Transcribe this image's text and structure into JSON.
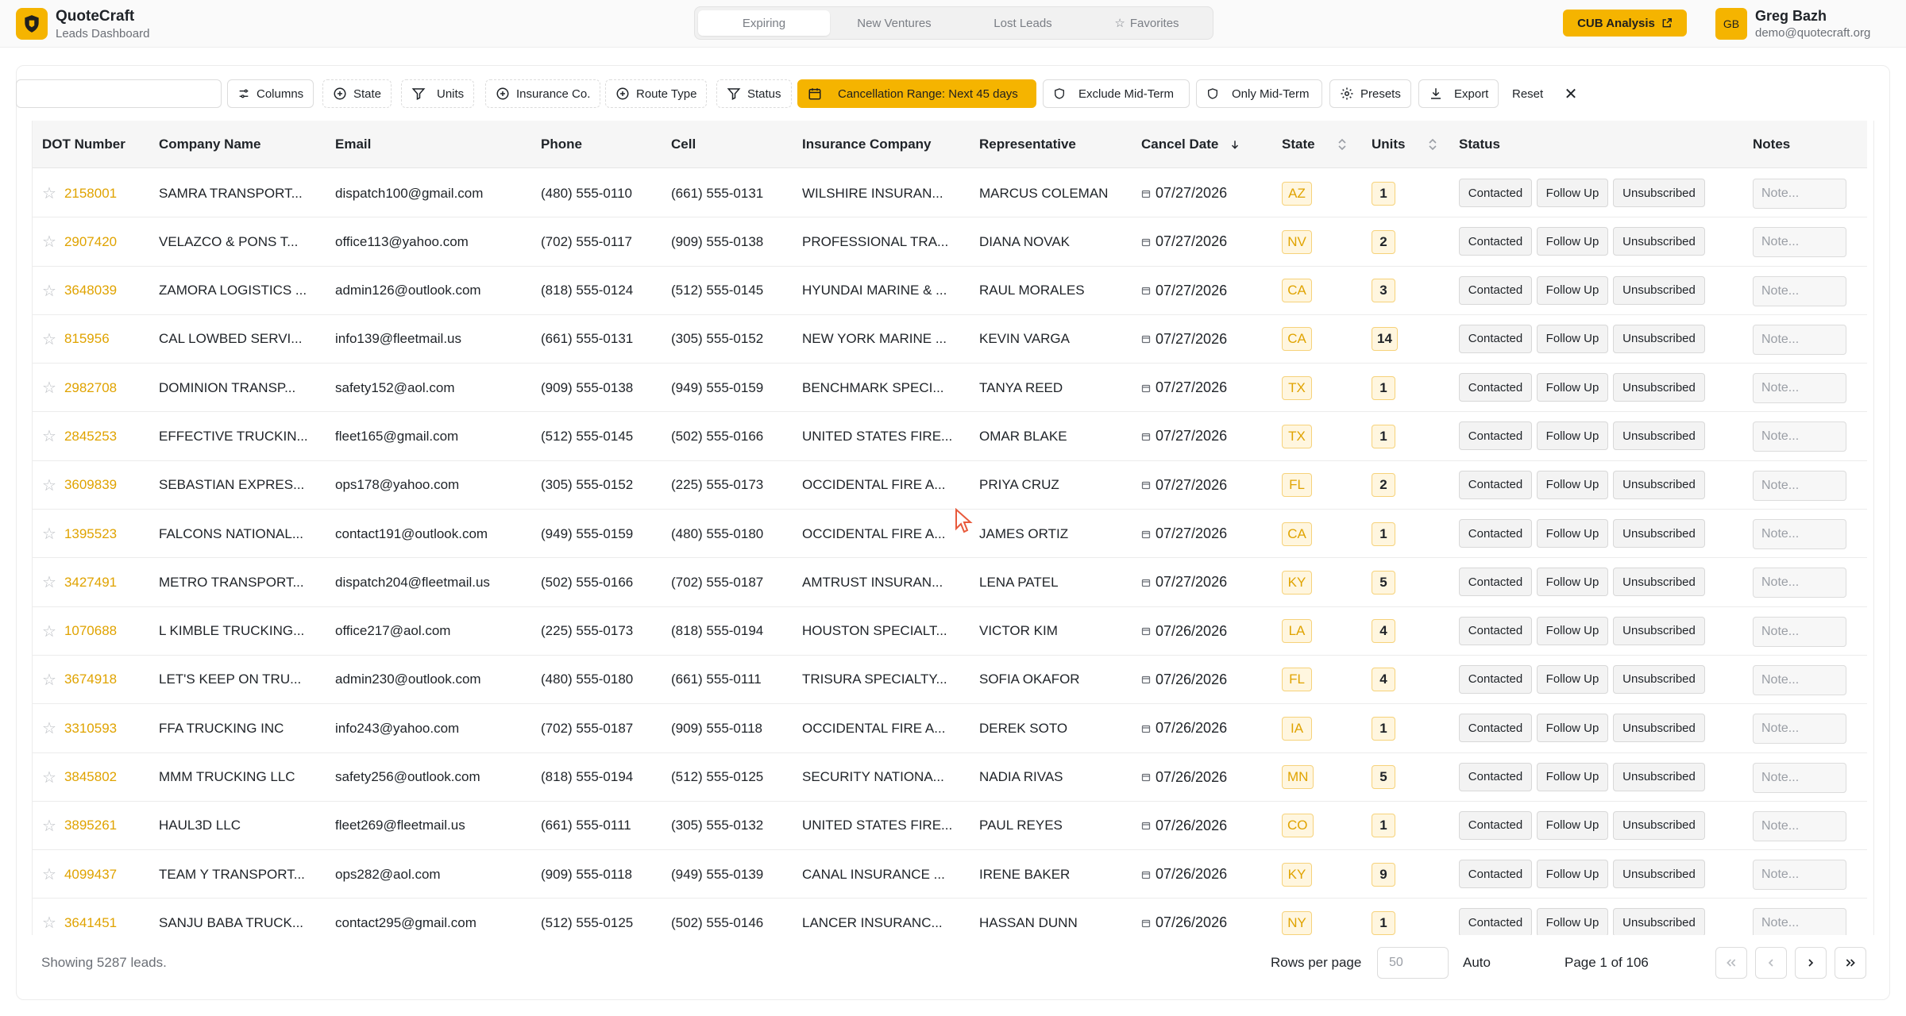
{
  "app": {
    "name": "QuoteCraft",
    "subtitle": "Leads Dashboard"
  },
  "tabs": [
    {
      "label": "Expiring",
      "active": true
    },
    {
      "label": "New Ventures",
      "active": false
    },
    {
      "label": "Lost Leads",
      "active": false
    },
    {
      "label": "Favorites",
      "active": false,
      "icon": "star-icon"
    }
  ],
  "header": {
    "cub_label": "CUB Analysis",
    "avatar_initials": "GB",
    "user_name": "Greg Bazh",
    "user_email": "demo@quotecraft.org"
  },
  "colors": {
    "accent": "#f5b400",
    "link": "#e0a300"
  },
  "toolbar": {
    "search_placeholder": "",
    "columns": "Columns",
    "state": "State",
    "units": "Units",
    "insurance": "Insurance Co.",
    "route": "Route Type",
    "status": "Status",
    "cancel_range": "Cancellation Range: Next 45 days",
    "exclude_mid": "Exclude Mid-Term",
    "only_mid": "Only Mid-Term",
    "presets": "Presets",
    "export": "Export",
    "reset": "Reset",
    "close": "✕"
  },
  "table": {
    "headers": {
      "dot": "DOT Number",
      "company": "Company Name",
      "email": "Email",
      "phone": "Phone",
      "cell": "Cell",
      "insurance": "Insurance Company",
      "rep": "Representative",
      "cancel": "Cancel Date",
      "state": "State",
      "units": "Units",
      "status": "Status",
      "notes": "Notes"
    },
    "status_buttons": {
      "contacted": "Contacted",
      "follow": "Follow Up",
      "unsub": "Unsubscribed"
    },
    "note_placeholder": "Note...",
    "rows": [
      {
        "dot": "2158001",
        "company": "SAMRA TRANSPORT...",
        "email": "dispatch100@gmail.com",
        "phone": "(480) 555-0110",
        "cell": "(661) 555-0131",
        "insurance": "WILSHIRE INSURAN...",
        "rep": "MARCUS COLEMAN",
        "date": "07/27/2026",
        "state": "AZ",
        "units": "1"
      },
      {
        "dot": "2907420",
        "company": "VELAZCO & PONS T...",
        "email": "office113@yahoo.com",
        "phone": "(702) 555-0117",
        "cell": "(909) 555-0138",
        "insurance": "PROFESSIONAL TRA...",
        "rep": "DIANA NOVAK",
        "date": "07/27/2026",
        "state": "NV",
        "units": "2"
      },
      {
        "dot": "3648039",
        "company": "ZAMORA LOGISTICS ...",
        "email": "admin126@outlook.com",
        "phone": "(818) 555-0124",
        "cell": "(512) 555-0145",
        "insurance": "HYUNDAI MARINE & ...",
        "rep": "RAUL MORALES",
        "date": "07/27/2026",
        "state": "CA",
        "units": "3"
      },
      {
        "dot": "815956",
        "company": "CAL LOWBED SERVI...",
        "email": "info139@fleetmail.us",
        "phone": "(661) 555-0131",
        "cell": "(305) 555-0152",
        "insurance": "NEW YORK MARINE ...",
        "rep": "KEVIN VARGA",
        "date": "07/27/2026",
        "state": "CA",
        "units": "14"
      },
      {
        "dot": "2982708",
        "company": "DOMINION TRANSP...",
        "email": "safety152@aol.com",
        "phone": "(909) 555-0138",
        "cell": "(949) 555-0159",
        "insurance": "BENCHMARK SPECI...",
        "rep": "TANYA REED",
        "date": "07/27/2026",
        "state": "TX",
        "units": "1"
      },
      {
        "dot": "2845253",
        "company": "EFFECTIVE TRUCKIN...",
        "email": "fleet165@gmail.com",
        "phone": "(512) 555-0145",
        "cell": "(502) 555-0166",
        "insurance": "UNITED STATES FIRE...",
        "rep": "OMAR BLAKE",
        "date": "07/27/2026",
        "state": "TX",
        "units": "1"
      },
      {
        "dot": "3609839",
        "company": "SEBASTIAN EXPRES...",
        "email": "ops178@yahoo.com",
        "phone": "(305) 555-0152",
        "cell": "(225) 555-0173",
        "insurance": "OCCIDENTAL FIRE A...",
        "rep": "PRIYA CRUZ",
        "date": "07/27/2026",
        "state": "FL",
        "units": "2"
      },
      {
        "dot": "1395523",
        "company": "FALCONS NATIONAL...",
        "email": "contact191@outlook.com",
        "phone": "(949) 555-0159",
        "cell": "(480) 555-0180",
        "insurance": "OCCIDENTAL FIRE A...",
        "rep": "JAMES ORTIZ",
        "date": "07/27/2026",
        "state": "CA",
        "units": "1"
      },
      {
        "dot": "3427491",
        "company": "METRO TRANSPORT...",
        "email": "dispatch204@fleetmail.us",
        "phone": "(502) 555-0166",
        "cell": "(702) 555-0187",
        "insurance": "AMTRUST INSURAN...",
        "rep": "LENA PATEL",
        "date": "07/27/2026",
        "state": "KY",
        "units": "5"
      },
      {
        "dot": "1070688",
        "company": "L KIMBLE TRUCKING...",
        "email": "office217@aol.com",
        "phone": "(225) 555-0173",
        "cell": "(818) 555-0194",
        "insurance": "HOUSTON SPECIALT...",
        "rep": "VICTOR KIM",
        "date": "07/26/2026",
        "state": "LA",
        "units": "4"
      },
      {
        "dot": "3674918",
        "company": "LET'S KEEP ON TRU...",
        "email": "admin230@outlook.com",
        "phone": "(480) 555-0180",
        "cell": "(661) 555-0111",
        "insurance": "TRISURA SPECIALTY...",
        "rep": "SOFIA OKAFOR",
        "date": "07/26/2026",
        "state": "FL",
        "units": "4"
      },
      {
        "dot": "3310593",
        "company": "FFA TRUCKING INC",
        "email": "info243@yahoo.com",
        "phone": "(702) 555-0187",
        "cell": "(909) 555-0118",
        "insurance": "OCCIDENTAL FIRE A...",
        "rep": "DEREK SOTO",
        "date": "07/26/2026",
        "state": "IA",
        "units": "1"
      },
      {
        "dot": "3845802",
        "company": "MMM TRUCKING LLC",
        "email": "safety256@outlook.com",
        "phone": "(818) 555-0194",
        "cell": "(512) 555-0125",
        "insurance": "SECURITY NATIONA...",
        "rep": "NADIA RIVAS",
        "date": "07/26/2026",
        "state": "MN",
        "units": "5"
      },
      {
        "dot": "3895261",
        "company": "HAUL3D LLC",
        "email": "fleet269@fleetmail.us",
        "phone": "(661) 555-0111",
        "cell": "(305) 555-0132",
        "insurance": "UNITED STATES FIRE...",
        "rep": "PAUL REYES",
        "date": "07/26/2026",
        "state": "CO",
        "units": "1"
      },
      {
        "dot": "4099437",
        "company": "TEAM Y TRANSPORT...",
        "email": "ops282@aol.com",
        "phone": "(909) 555-0118",
        "cell": "(949) 555-0139",
        "insurance": "CANAL INSURANCE ...",
        "rep": "IRENE BAKER",
        "date": "07/26/2026",
        "state": "KY",
        "units": "9"
      },
      {
        "dot": "3641451",
        "company": "SANJU BABA TRUCK...",
        "email": "contact295@gmail.com",
        "phone": "(512) 555-0125",
        "cell": "(502) 555-0146",
        "insurance": "LANCER INSURANC...",
        "rep": "HASSAN DUNN",
        "date": "07/26/2026",
        "state": "NY",
        "units": "1"
      }
    ]
  },
  "footer": {
    "showing": "Showing 5287 leads.",
    "rows_per_page_label": "Rows per page",
    "rows_per_page_value": "50",
    "auto": "Auto",
    "page": "Page 1 of 106"
  }
}
